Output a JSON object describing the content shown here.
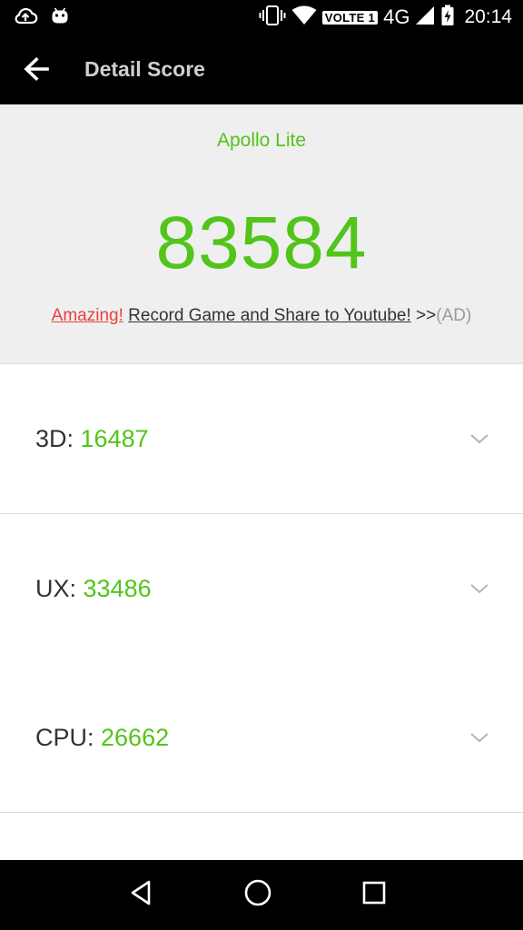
{
  "status_bar": {
    "network_badge": "VOLTE 1",
    "network_type": "4G",
    "time": "20:14",
    "icons": [
      "cloud-upload-icon",
      "android-icon",
      "vibrate-icon",
      "wifi-icon",
      "signal-icon",
      "battery-charging-icon"
    ]
  },
  "app_bar": {
    "title": "Detail Score",
    "back_icon": "arrow-back-icon"
  },
  "summary": {
    "device_name": "Apollo Lite",
    "total_score": "83584",
    "promo": {
      "highlight": "Amazing!",
      "link": "Record Game and Share to Youtube!",
      "arrows": ">>",
      "ad": "(AD)"
    }
  },
  "scores": [
    {
      "label": "3D: ",
      "value": "16487"
    },
    {
      "label": "UX: ",
      "value": "33486"
    },
    {
      "label": "CPU: ",
      "value": "26662"
    }
  ],
  "colors": {
    "accent_green": "#52c41a",
    "promo_red": "#e8423c",
    "header_bg": "#000000",
    "summary_bg": "#efefef"
  },
  "nav_bar": {
    "icons": [
      "back-triangle-icon",
      "home-circle-icon",
      "recents-square-icon"
    ]
  }
}
